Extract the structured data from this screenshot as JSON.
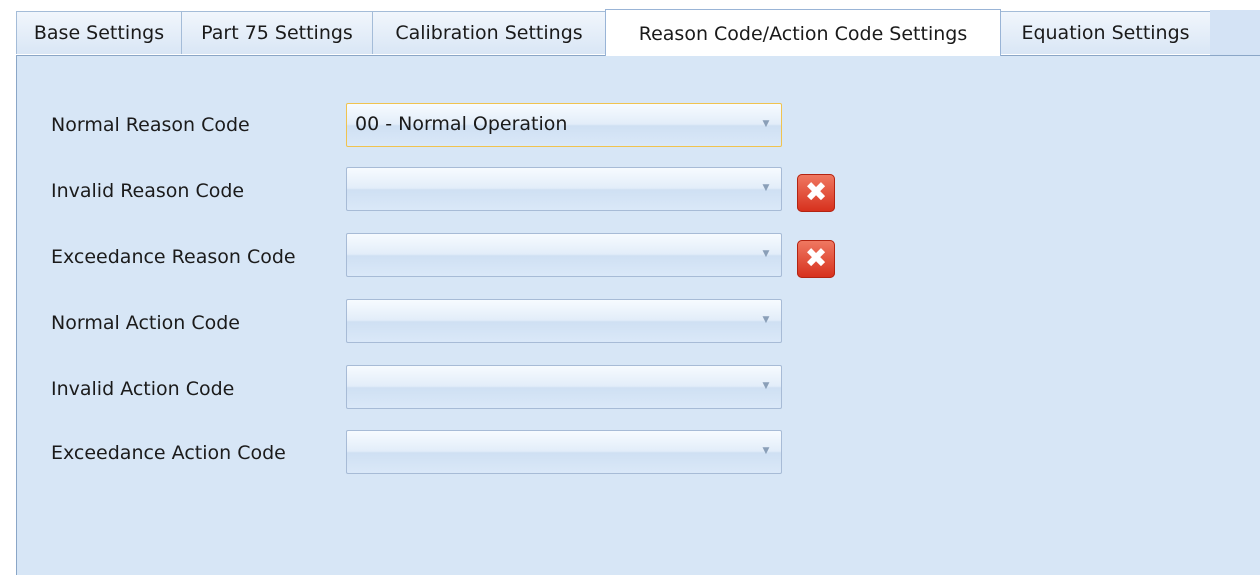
{
  "tabs": [
    {
      "label": "Base Settings"
    },
    {
      "label": "Part 75 Settings"
    },
    {
      "label": "Calibration Settings"
    },
    {
      "label": "Reason Code/Action Code Settings"
    },
    {
      "label": "Equation Settings"
    }
  ],
  "active_tab": "Reason Code/Action Code Settings",
  "fields": [
    {
      "label": "Normal Reason Code",
      "value": "00 - Normal Operation"
    },
    {
      "label": "Invalid Reason Code",
      "value": ""
    },
    {
      "label": "Exceedance Reason Code",
      "value": ""
    },
    {
      "label": "Normal Action Code",
      "value": ""
    },
    {
      "label": "Invalid Action Code",
      "value": ""
    },
    {
      "label": "Exceedance Action Code",
      "value": ""
    }
  ],
  "icons": {
    "clear": "close-icon",
    "dropdown": "chevron-down-icon"
  },
  "colors": {
    "panel_background": "#d7e6f6",
    "focus_border": "#f0c34f",
    "clear_button": "#d62f1c"
  }
}
